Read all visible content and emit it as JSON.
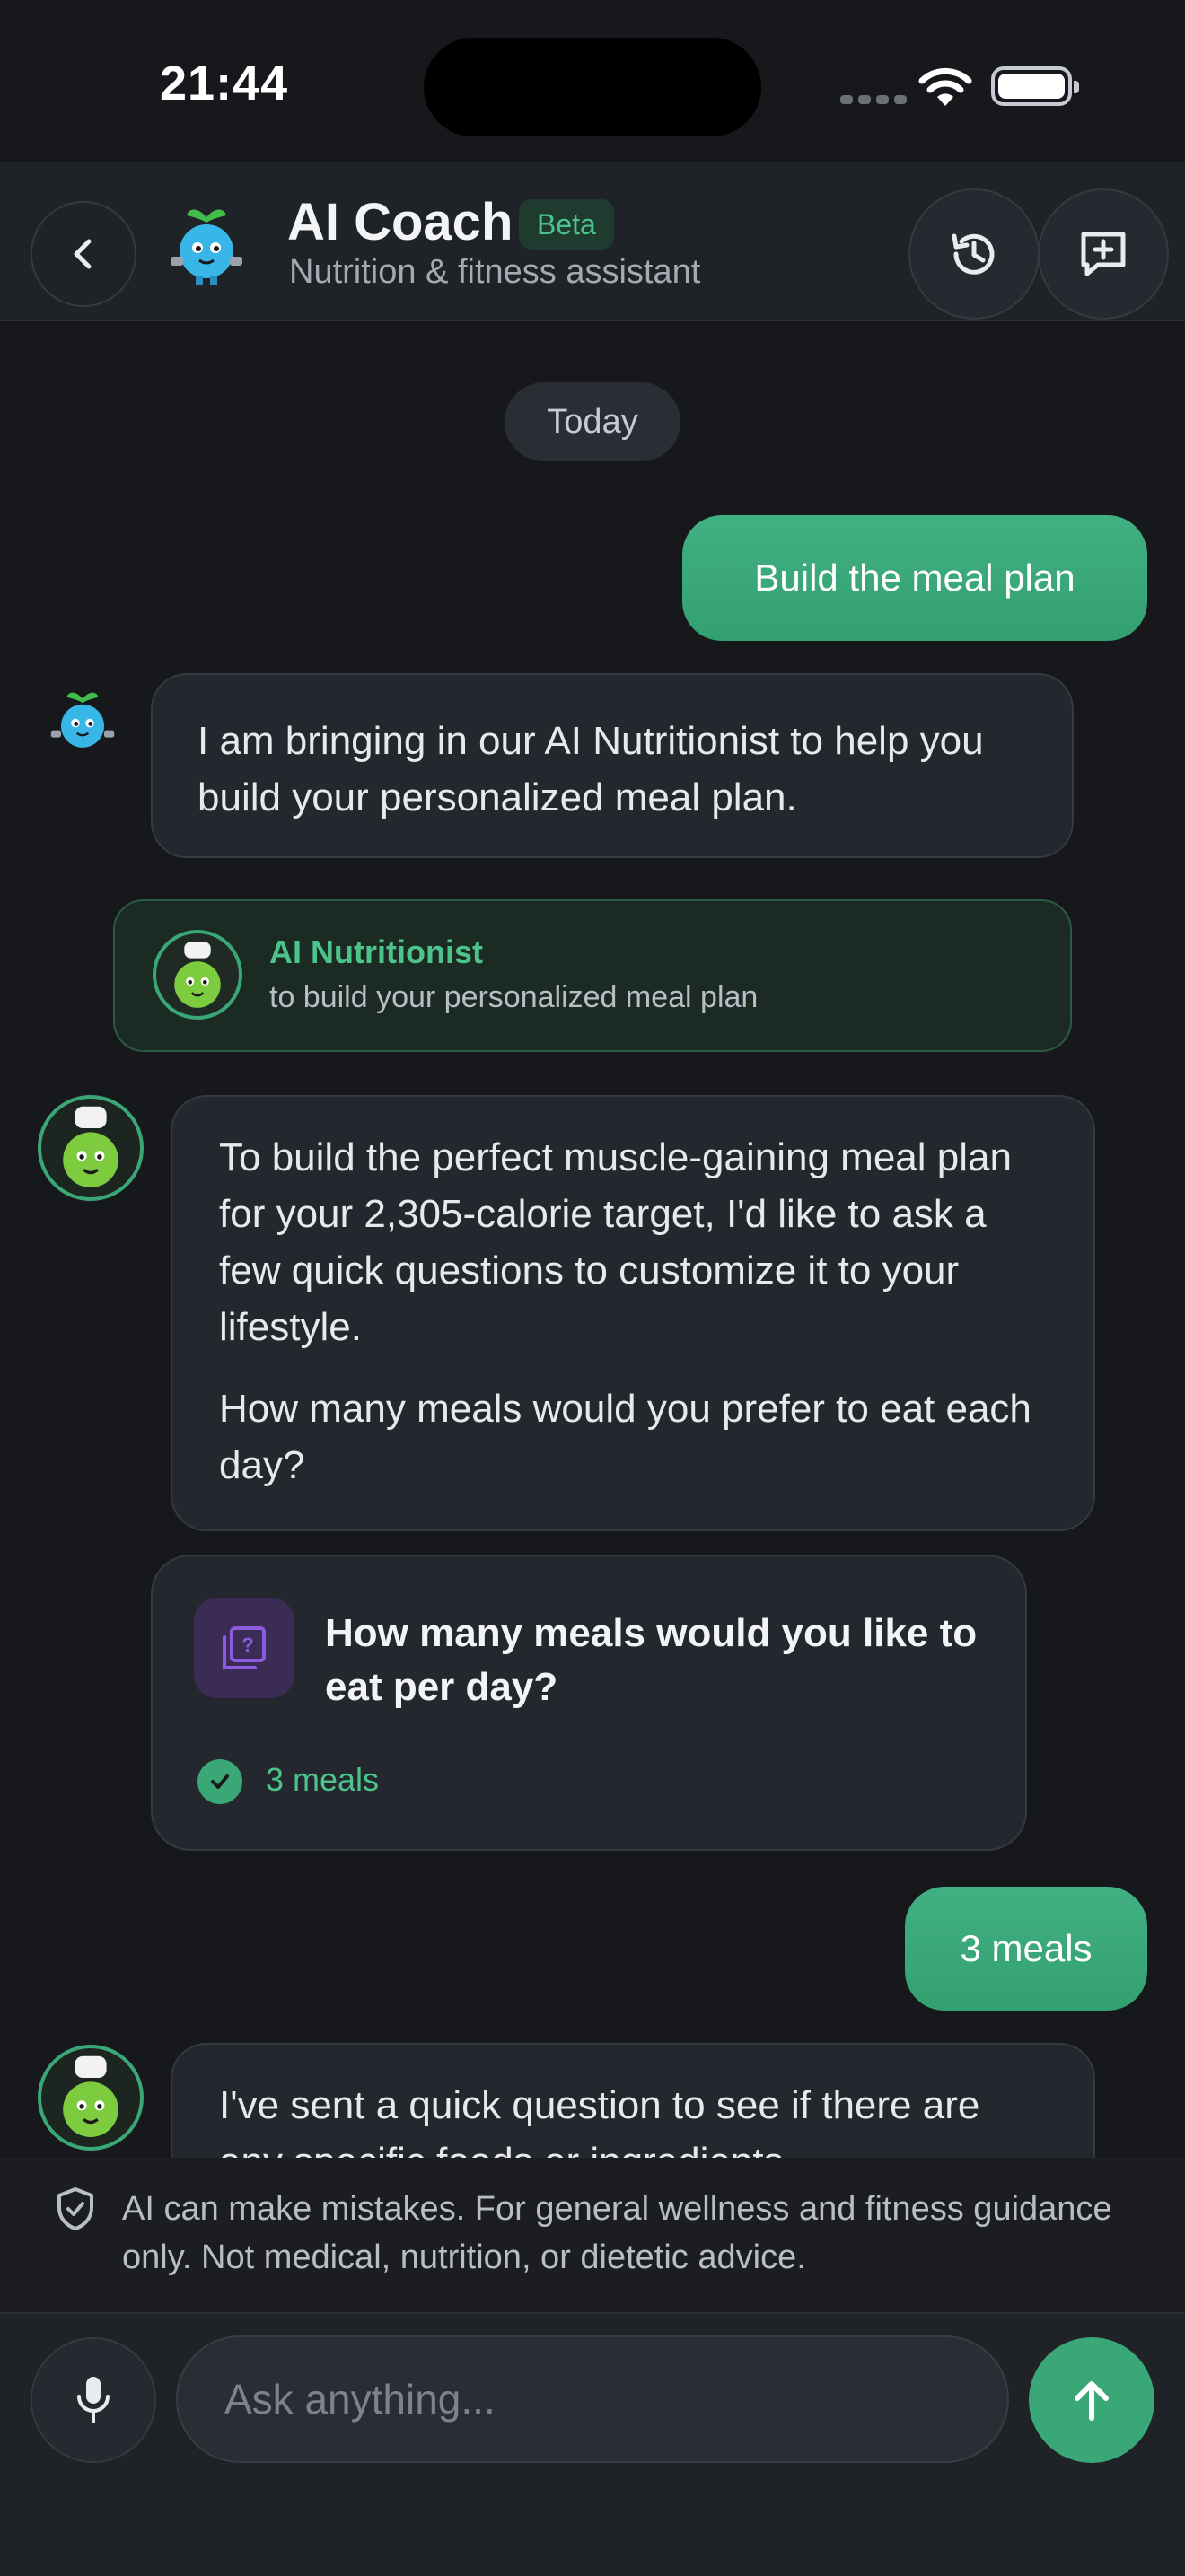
{
  "status_bar": {
    "time": "21:44"
  },
  "header": {
    "title": "AI Coach",
    "badge": "Beta",
    "subtitle": "Nutrition & fitness assistant"
  },
  "chat": {
    "date_label": "Today",
    "messages": [
      {
        "role": "user",
        "text": "Build the meal plan"
      },
      {
        "role": "coach",
        "text": "I am bringing in our AI Nutritionist to help you build your personalized meal plan."
      },
      {
        "role": "handoff",
        "title": "AI Nutritionist",
        "subtitle": "to build your personalized meal plan"
      },
      {
        "role": "nutritionist",
        "paragraph1": "To build the perfect muscle-gaining meal plan for your 2,305-calorie target, I'd like to ask a few quick questions to customize it to your lifestyle.",
        "paragraph2": "How many meals would you prefer to eat each day?"
      },
      {
        "role": "question_card",
        "question": "How many meals would you like to eat per day?",
        "answer": "3 meals"
      },
      {
        "role": "user",
        "text": "3 meals"
      },
      {
        "role": "nutritionist",
        "text": "I've sent a quick question to see if there are any specific foods or ingredients"
      }
    ]
  },
  "disclaimer": "AI can make mistakes. For general wellness and fitness guidance only. Not medical, nutrition, or dietetic advice.",
  "composer": {
    "placeholder": "Ask anything..."
  },
  "colors": {
    "accent": "#3aa777",
    "background": "#16181c",
    "bubble": "#24272d"
  }
}
